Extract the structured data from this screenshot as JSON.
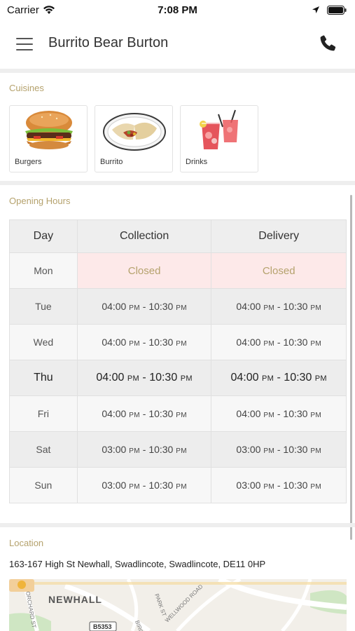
{
  "status_bar": {
    "carrier": "Carrier",
    "time": "7:08 PM"
  },
  "nav": {
    "title": "Burrito Bear Burton"
  },
  "cuisines": {
    "label": "Cuisines",
    "items": [
      {
        "name": "Burgers",
        "icon": "burger-image"
      },
      {
        "name": "Burrito",
        "icon": "burrito-image"
      },
      {
        "name": "Drinks",
        "icon": "drinks-image"
      }
    ]
  },
  "opening_hours": {
    "label": "Opening Hours",
    "headers": {
      "day": "Day",
      "collection": "Collection",
      "delivery": "Delivery"
    },
    "rows": [
      {
        "day": "Mon",
        "collection": "Closed",
        "delivery": "Closed"
      },
      {
        "day": "Tue",
        "collection": {
          "open": "04:00",
          "close": "10:30"
        },
        "delivery": {
          "open": "04:00",
          "close": "10:30"
        }
      },
      {
        "day": "Wed",
        "collection": {
          "open": "04:00",
          "close": "10:30"
        },
        "delivery": {
          "open": "04:00",
          "close": "10:30"
        }
      },
      {
        "day": "Thu",
        "collection": {
          "open": "04:00",
          "close": "10:30"
        },
        "delivery": {
          "open": "04:00",
          "close": "10:30"
        }
      },
      {
        "day": "Fri",
        "collection": {
          "open": "04:00",
          "close": "10:30"
        },
        "delivery": {
          "open": "04:00",
          "close": "10:30"
        }
      },
      {
        "day": "Sat",
        "collection": {
          "open": "03:00",
          "close": "10:30"
        },
        "delivery": {
          "open": "03:00",
          "close": "10:30"
        }
      },
      {
        "day": "Sun",
        "collection": {
          "open": "03:00",
          "close": "10:30"
        },
        "delivery": {
          "open": "03:00",
          "close": "10:30"
        }
      }
    ],
    "meridiem": "PM",
    "separator": " - "
  },
  "location": {
    "label": "Location",
    "address": "163-167 High St Newhall, Swadlincote, Swadlincote, DE11 0HP",
    "map_labels": {
      "area": "NEWHALL",
      "road_sign": "B5353",
      "street_1": "BIRCH AVE",
      "street_2": "PARK ST",
      "street_3": "WELLWOOD ROAD",
      "street_4": "ORCHARD ST"
    }
  },
  "colors": {
    "accent": "#b5a26d",
    "closed_bg": "#fde9e9",
    "divider": "#eeeeee"
  }
}
